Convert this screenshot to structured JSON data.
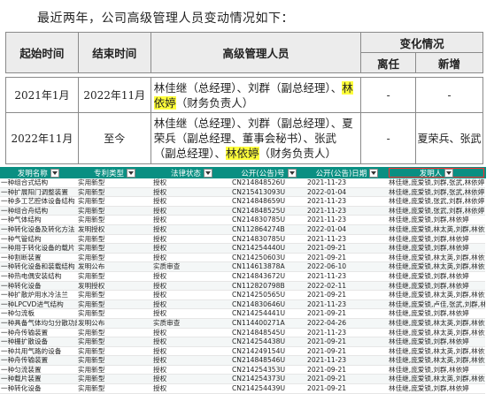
{
  "heading": "最近两年，公司高级管理人员变动情况如下：",
  "mgmt_table": {
    "headers": {
      "start": "起始时间",
      "end": "结束时间",
      "managers": "高级管理人员",
      "change": "变化情况",
      "left": "离任",
      "added": "新增"
    },
    "rows": [
      {
        "start": "2021年1月",
        "end": "2022年11月",
        "managers_before": "林佳继（总经理）、刘群（副总经理）、",
        "managers_hl": "林依婷",
        "managers_after": "（财务负责人）",
        "left": "-",
        "added": "-"
      },
      {
        "start": "2022年11月",
        "end": "至今",
        "managers_before": "林佳继（总经理）、刘群（副总经理）、夏荣兵（副总经理、董事会秘书）、张武（副总经理）、",
        "managers_hl": "林依婷",
        "managers_after": "（财务负责人）",
        "left": "-",
        "added": "夏荣兵、张武"
      }
    ]
  },
  "patent_table": {
    "columns": [
      "发明名称",
      "专利类型",
      "法律状态",
      "公开(公告)号",
      "公开(公告)日期",
      "发明人"
    ],
    "selected_column": "发明人",
    "rows": [
      [
        "一种组合式结构",
        "实用新型",
        "授权",
        "CN214848526U",
        "2021-11-23",
        "林佳继,庞爱锁,刘群,张武,林依婷"
      ],
      [
        "一种扩展阳门调整装置",
        "实用新型",
        "授权",
        "CN215413093U",
        "2022-01-04",
        "林佳继,庞爱锁,刘群,张武,林依婷"
      ],
      [
        "一种多工艺腔体设备结构",
        "实用新型",
        "授权",
        "CN214848659U",
        "2021-11-23",
        "林佳继,庞爱锁,张武,刘群,林依婷"
      ],
      [
        "一种组合舟结构",
        "实用新型",
        "授权",
        "CN214848525U",
        "2021-11-23",
        "林佳继,庞爱锁,张武,刘群,林依婷"
      ],
      [
        "一种气体结构",
        "实用新型",
        "授权",
        "CN214830785U",
        "2021-11-23",
        "林佳继,庞爱锁,刘群,林依婷"
      ],
      [
        "一种转化设备及转化方法",
        "发明授权",
        "授权",
        "CN112864274B",
        "2022-01-04",
        "林佳继,庞爱锁,林太英,刘群,林依婷"
      ],
      [
        "一种气管结构",
        "实用新型",
        "授权",
        "CN214830785U",
        "2021-11-23",
        "林佳继,庞爱锁,刘群,林依婷"
      ],
      [
        "一种用于转化设备的载片",
        "实用新型",
        "授权",
        "CN214254440U",
        "2021-09-21",
        "林佳继,庞爱锁,刘群,林依婷"
      ],
      [
        "一种割断装置",
        "实用新型",
        "授权",
        "CN214250603U",
        "2021-09-21",
        "林佳继,庞爱锁,林太英,刘群,林依婷"
      ],
      [
        "一种转化设备和装载结构",
        "发明公布",
        "实质审查",
        "CN114613878A",
        "2022-06-10",
        "林佳继,庞爱锁,林太英,刘群,林依婷"
      ],
      [
        "一种热电偶安装结构",
        "实用新型",
        "授权",
        "CN214843672U",
        "2021-11-23",
        "林佳继,庞爱锁,刘群,林依婷"
      ],
      [
        "一种转化设备",
        "发明授权",
        "授权",
        "CN112820798B",
        "2022-02-11",
        "林佳继,庞爱锁,刘群,林依婷"
      ],
      [
        "一种扩散炉用水冷法兰",
        "实用新型",
        "授权",
        "CN214250565U",
        "2021-09-21",
        "林佳继,庞爱锁,林太英,刘群,林依婷"
      ],
      [
        "一种LPCVD进气结构",
        "实用新型",
        "授权",
        "CN214830646U",
        "2021-11-23",
        "林佳继,庞爱锁,卢佳,张武,刘群,林依婷"
      ],
      [
        "一种匀流板",
        "实用新型",
        "授权",
        "CN214254441U",
        "2021-09-21",
        "林佳继,庞爱锁,刘群,林依婷"
      ],
      [
        "一种具备气体均匀分散功能",
        "发明公布",
        "实质审查",
        "CN114400271A",
        "2022-04-26",
        "林佳继,庞爱锁,林太英,刘群,林依婷"
      ],
      [
        "一种舟传输装置",
        "实用新型",
        "授权",
        "CN214848545U",
        "2021-11-23",
        "林佳继,庞爱锁,林太英,刘群,林依婷"
      ],
      [
        "一种栅扩散设备",
        "实用新型",
        "授权",
        "CN214254438U",
        "2021-09-21",
        "林佳继,庞爱锁,刘群,林依婷"
      ],
      [
        "一种共用气路的设备",
        "实用新型",
        "授权",
        "CN214249154U",
        "2021-09-21",
        "林佳继,庞爱锁,林太英,刘群,林依婷"
      ],
      [
        "一种舟传输装置",
        "实用新型",
        "授权",
        "CN214848546U",
        "2021-11-23",
        "林佳继,庞爱锁,林太英,刘群,林依婷"
      ],
      [
        "一种匀流装置",
        "实用新型",
        "授权",
        "CN214254353U",
        "2021-09-21",
        "林佳继,庞爱锁,刘群,林依婷"
      ],
      [
        "一种载片装置",
        "实用新型",
        "授权",
        "CN214254373U",
        "2021-09-21",
        "林佳继,庞爱锁,林太英,刘群,林依婷"
      ],
      [
        "一种转化设备",
        "实用新型",
        "授权",
        "CN214254439U",
        "2021-09-21",
        "林佳继,庞爱锁,刘群,林依婷"
      ]
    ]
  }
}
